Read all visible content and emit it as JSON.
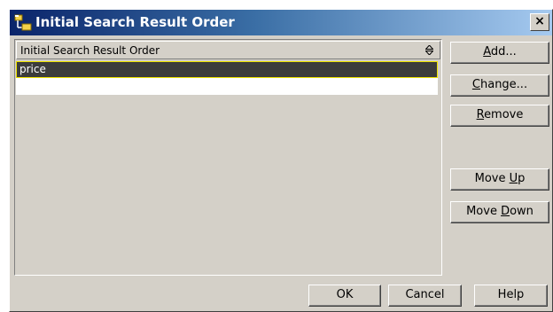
{
  "window": {
    "title": "Initial Search Result Order",
    "close_label": "×"
  },
  "list": {
    "column_header": "Initial Search Result Order",
    "rows": [
      "price",
      ""
    ]
  },
  "side_buttons": {
    "add": {
      "pre": "",
      "key": "A",
      "post": "dd..."
    },
    "change": {
      "pre": "",
      "key": "C",
      "post": "hange..."
    },
    "remove": {
      "pre": "",
      "key": "R",
      "post": "emove"
    },
    "move_up": {
      "pre": "Move ",
      "key": "U",
      "post": "p"
    },
    "move_down": {
      "pre": "Move ",
      "key": "D",
      "post": "own"
    }
  },
  "footer_buttons": {
    "ok": "OK",
    "cancel": "Cancel",
    "help": "Help"
  },
  "colors": {
    "titlebar_start": "#0a246a",
    "titlebar_end": "#a6caf0",
    "dialog_bg": "#d4d0c8",
    "selection_bg": "#3c3c3c",
    "selection_border": "#f0e400"
  }
}
